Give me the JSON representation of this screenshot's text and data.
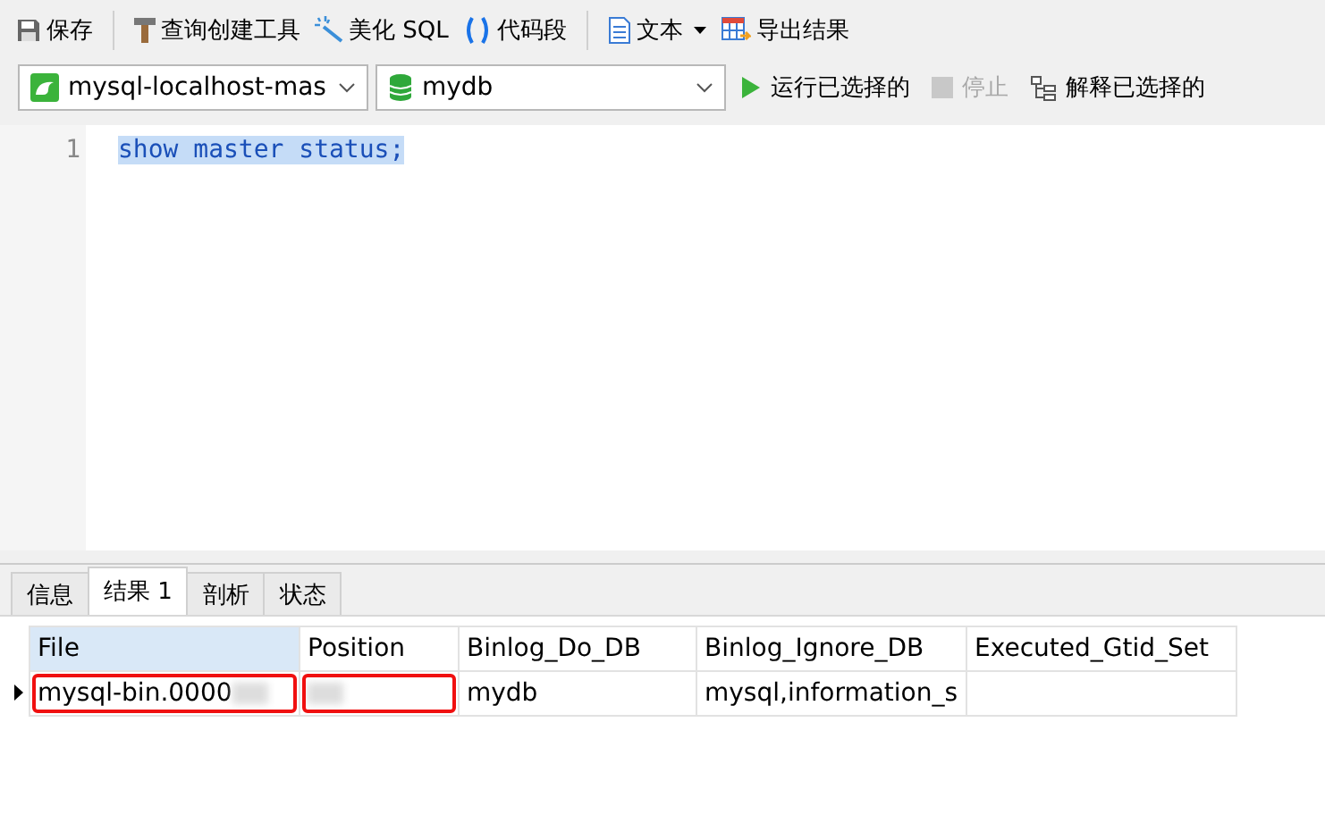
{
  "toolbar": [
    {
      "kind": "save",
      "label": "保存"
    },
    {
      "kind": "divider"
    },
    {
      "kind": "builder",
      "label": "查询创建工具"
    },
    {
      "kind": "beautify",
      "label": "美化 SQL"
    },
    {
      "kind": "snippet",
      "label": "代码段"
    },
    {
      "kind": "divider"
    },
    {
      "kind": "text",
      "label": "文本",
      "dropdown": true
    },
    {
      "kind": "export",
      "label": "导出结果"
    }
  ],
  "connection": {
    "value": "mysql-localhost-mas"
  },
  "database": {
    "value": "mydb"
  },
  "actions": [
    {
      "kind": "run",
      "label": "运行已选择的",
      "disabled": false
    },
    {
      "kind": "stop",
      "label": "停止",
      "disabled": true
    },
    {
      "kind": "explain",
      "label": "解释已选择的",
      "disabled": false
    }
  ],
  "editor": {
    "lines": [
      {
        "number": "1",
        "code": "show master status;",
        "selected": true
      }
    ]
  },
  "result_tabs": [
    {
      "label": "信息",
      "selected": false
    },
    {
      "label": "结果 1",
      "selected": true
    },
    {
      "label": "剖析",
      "selected": false
    },
    {
      "label": "状态",
      "selected": false
    }
  ],
  "table": {
    "columns": [
      {
        "label": "File",
        "selected": true
      },
      {
        "label": "Position",
        "selected": false
      },
      {
        "label": "Binlog_Do_DB",
        "selected": false
      },
      {
        "label": "Binlog_Ignore_DB",
        "selected": false
      },
      {
        "label": "Executed_Gtid_Set",
        "selected": false
      }
    ],
    "rows": [
      {
        "current": true,
        "cells": [
          {
            "text": "mysql-bin.0000",
            "highlighted": true,
            "blurred": true
          },
          {
            "text": "",
            "highlighted": true,
            "blurred": true
          },
          {
            "text": "mydb",
            "highlighted": false,
            "blurred": false
          },
          {
            "text": "mysql,information_s",
            "highlighted": false,
            "blurred": false
          },
          {
            "text": "",
            "highlighted": false,
            "blurred": false
          }
        ]
      }
    ]
  }
}
